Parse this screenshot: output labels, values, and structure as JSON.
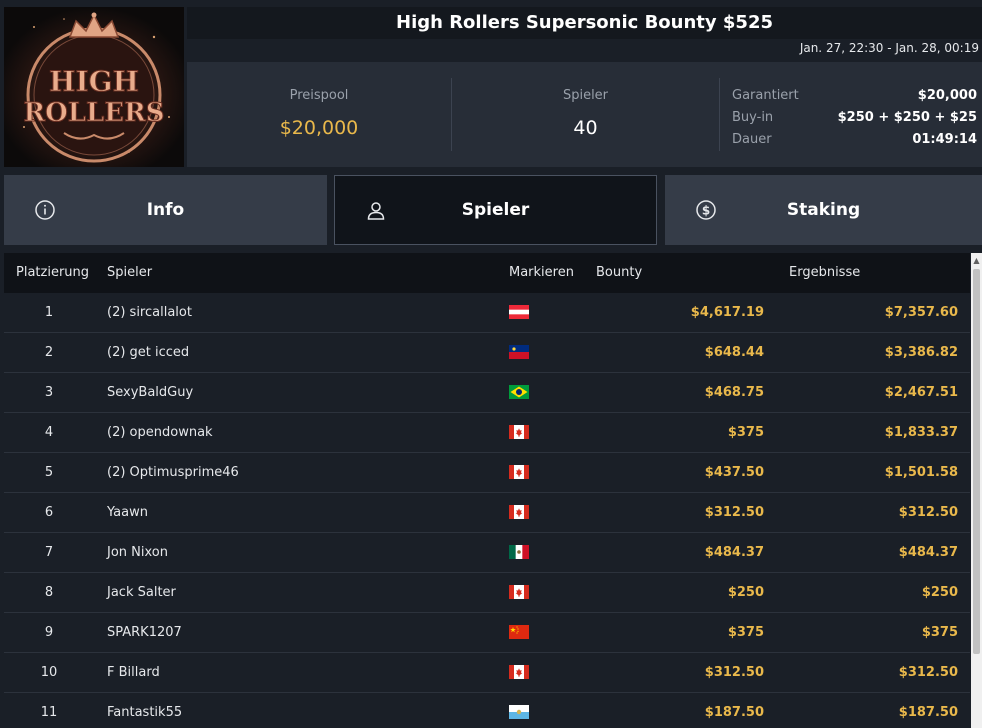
{
  "logo": {
    "line1": "HIGH",
    "line2": "ROLLERS"
  },
  "header": {
    "title": "High Rollers Supersonic Bounty $525",
    "date_range": "Jan. 27, 22:30 - Jan. 28, 00:19"
  },
  "stats": {
    "prize_pool": {
      "label": "Preispool",
      "value": "$20,000"
    },
    "players": {
      "label": "Spieler",
      "value": "40"
    },
    "details": [
      {
        "label": "Garantiert",
        "value": "$20,000"
      },
      {
        "label": "Buy-in",
        "value": "$250 + $250 + $25"
      },
      {
        "label": "Dauer",
        "value": "01:49:14"
      }
    ]
  },
  "tabs": [
    {
      "label": "Info",
      "icon": "info-icon"
    },
    {
      "label": "Spieler",
      "icon": "user-icon",
      "active": true
    },
    {
      "label": "Staking",
      "icon": "dollar-icon"
    }
  ],
  "table": {
    "headers": {
      "rank": "Platzierung",
      "player": "Spieler",
      "mark": "Markieren",
      "bounty": "Bounty",
      "results": "Ergebnisse"
    },
    "rows": [
      {
        "rank": "1",
        "player": "(2) sircallalot",
        "flag": "austria",
        "bounty": "$4,617.19",
        "result": "$7,357.60"
      },
      {
        "rank": "2",
        "player": "(2) get icced",
        "flag": "liechtenstein",
        "bounty": "$648.44",
        "result": "$3,386.82"
      },
      {
        "rank": "3",
        "player": "SexyBaldGuy",
        "flag": "brazil",
        "bounty": "$468.75",
        "result": "$2,467.51"
      },
      {
        "rank": "4",
        "player": "(2) opendownak",
        "flag": "canada",
        "bounty": "$375",
        "result": "$1,833.37"
      },
      {
        "rank": "5",
        "player": "(2) Optimusprime46",
        "flag": "canada",
        "bounty": "$437.50",
        "result": "$1,501.58"
      },
      {
        "rank": "6",
        "player": "Yaawn",
        "flag": "canada",
        "bounty": "$312.50",
        "result": "$312.50"
      },
      {
        "rank": "7",
        "player": "Jon Nixon",
        "flag": "mexico",
        "bounty": "$484.37",
        "result": "$484.37"
      },
      {
        "rank": "8",
        "player": "Jack Salter",
        "flag": "canada",
        "bounty": "$250",
        "result": "$250"
      },
      {
        "rank": "9",
        "player": "SPARK1207",
        "flag": "china",
        "bounty": "$375",
        "result": "$375"
      },
      {
        "rank": "10",
        "player": "F Billard",
        "flag": "canada",
        "bounty": "$312.50",
        "result": "$312.50"
      },
      {
        "rank": "11",
        "player": "Fantastik55",
        "flag": "san-marino",
        "bounty": "$187.50",
        "result": "$187.50"
      }
    ]
  },
  "colors": {
    "accent_gold": "#e9b84b",
    "background": "#1a1f27",
    "panel": "#272d37",
    "tab": "#353c48"
  }
}
